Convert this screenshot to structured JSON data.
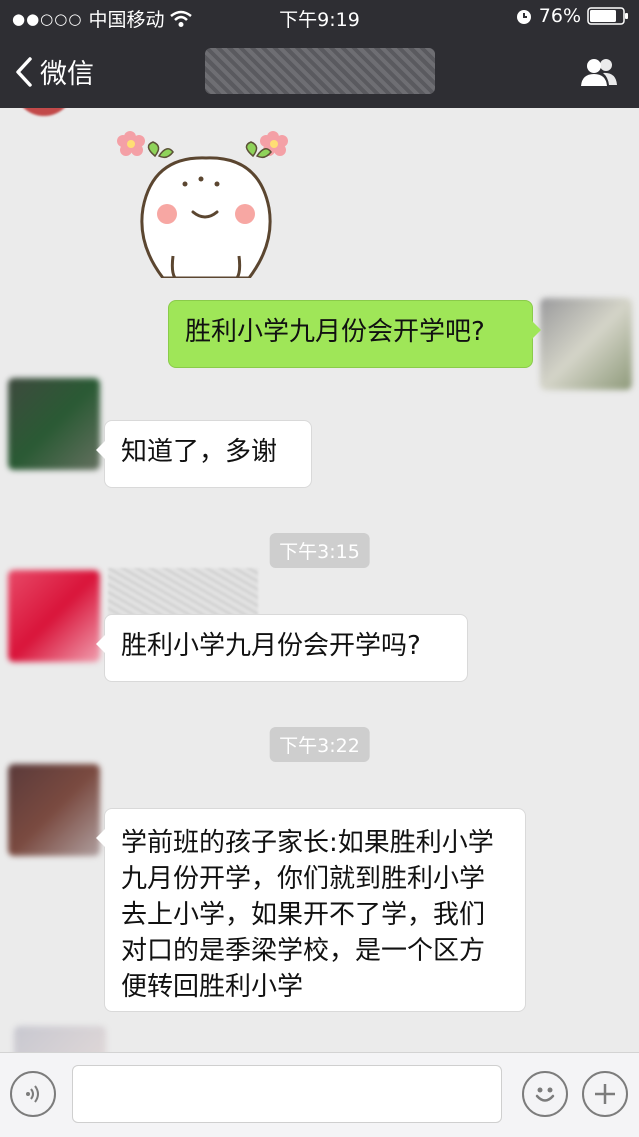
{
  "status_bar": {
    "signal": "●●○○○",
    "carrier": "中国移动",
    "time": "下午9:19",
    "battery_percent": "76%"
  },
  "nav": {
    "back_label": "微信",
    "title": ""
  },
  "messages": [
    {
      "type": "sticker",
      "direction": "in",
      "sticker": "smiling-bun-sticker"
    },
    {
      "type": "text",
      "direction": "out",
      "text": "胜利小学九月份会开学吧?"
    },
    {
      "type": "text",
      "direction": "in",
      "text": "知道了，多谢"
    },
    {
      "type": "timestamp",
      "text": "下午3:15"
    },
    {
      "type": "text",
      "direction": "in",
      "text": "胜利小学九月份会开学吗?"
    },
    {
      "type": "timestamp",
      "text": "下午3:22"
    },
    {
      "type": "text",
      "direction": "in",
      "text": "学前班的孩子家长:如果胜利小学九月份开学，你们就到胜利小学去上小学，如果开不了学，我们对口的是季梁学校，是一个区方便转回胜利小学"
    }
  ],
  "colors": {
    "bar_bg": "#2e2e33",
    "chat_bg": "#ebebeb",
    "outgoing_bubble": "#9fe658",
    "incoming_bubble": "#ffffff"
  },
  "icons": {
    "back": "chevron-left-icon",
    "contacts": "contacts-icon",
    "voice": "voice-icon",
    "emoji": "emoji-icon",
    "add": "plus-icon",
    "wifi": "wifi-icon",
    "alarm": "alarm-icon",
    "battery": "battery-icon"
  }
}
